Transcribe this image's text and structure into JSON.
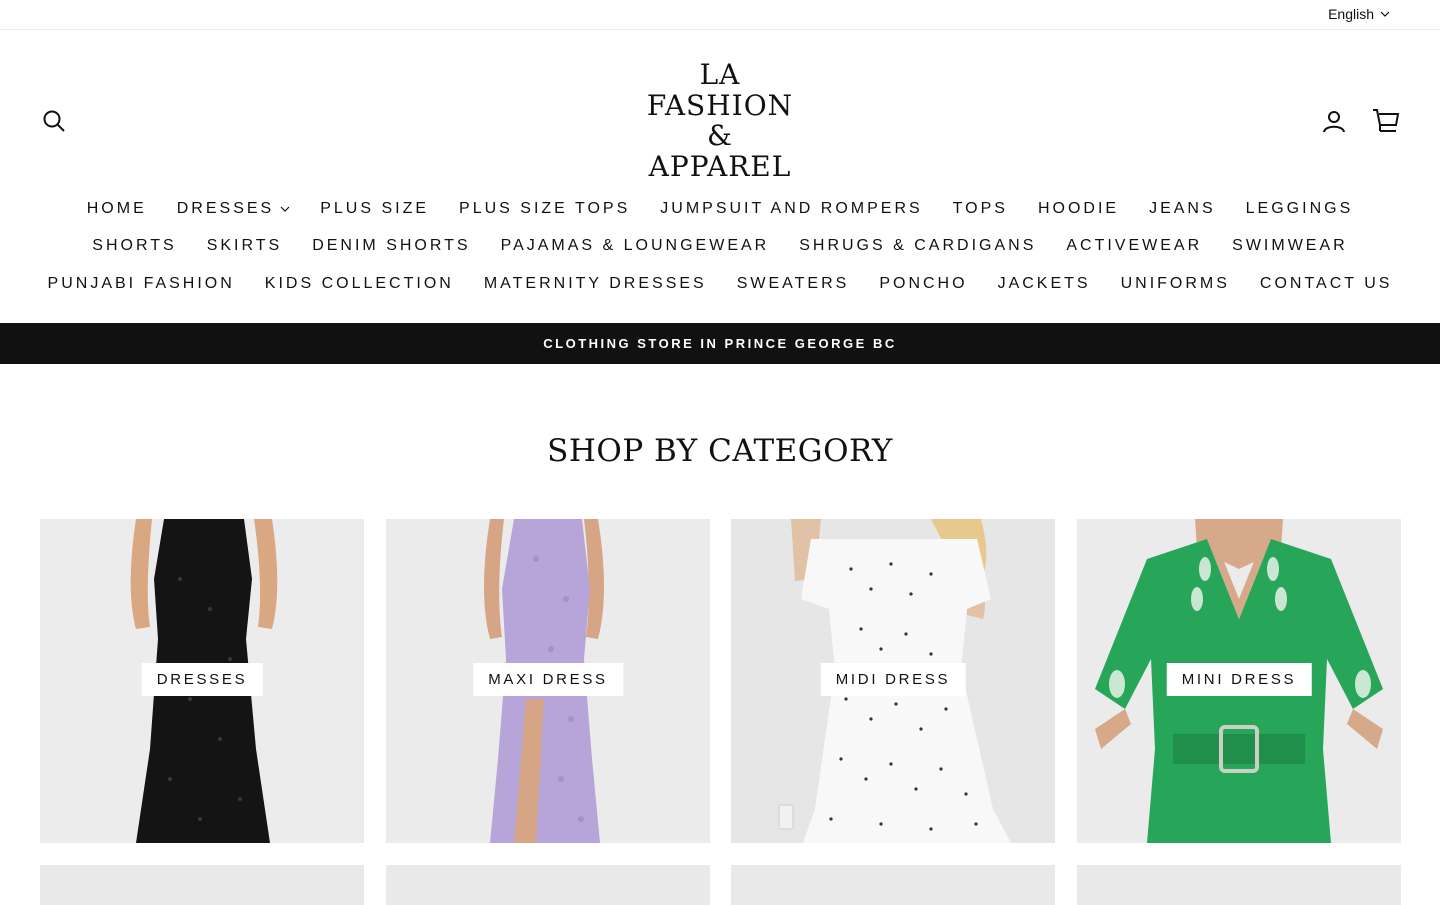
{
  "topbar": {
    "language": "English"
  },
  "logo": {
    "lines": [
      "LA",
      "FASHION",
      "&",
      "APPAREL"
    ]
  },
  "icons": {
    "search": "search-icon",
    "account": "user-icon",
    "cart": "cart-icon",
    "chevron": "chevron-down-icon"
  },
  "nav": {
    "row1": [
      "HOME",
      "DRESSES",
      "PLUS SIZE",
      "PLUS SIZE TOPS",
      "JUMPSUIT AND ROMPERS",
      "TOPS",
      "HOODIE",
      "JEANS",
      "LEGGINGS"
    ],
    "row2": [
      "SHORTS",
      "SKIRTS",
      "DENIM SHORTS",
      "PAJAMAS & LOUNGEWEAR",
      "SHRUGS & CARDIGANS",
      "ACTIVEWEAR",
      "SWIMWEAR"
    ],
    "row3": [
      "PUNJABI FASHION",
      "KIDS COLLECTION",
      "MATERNITY DRESSES",
      "SWEATERS",
      "PONCHO",
      "JACKETS",
      "UNIFORMS",
      "CONTACT US"
    ]
  },
  "announcement": "CLOTHING STORE IN PRINCE GEORGE BC",
  "section": {
    "title": "SHOP BY CATEGORY"
  },
  "categories": [
    {
      "label": "DRESSES",
      "dress_color": "#141414"
    },
    {
      "label": "MAXI DRESS",
      "dress_color": "#b7a4d8"
    },
    {
      "label": "MIDI DRESS",
      "dress_color": "#f8f8f8"
    },
    {
      "label": "MINI DRESS",
      "dress_color": "#27a65a"
    }
  ],
  "colors": {
    "announcement_bg": "#111111",
    "tile_bg": "#e8e8e8"
  }
}
